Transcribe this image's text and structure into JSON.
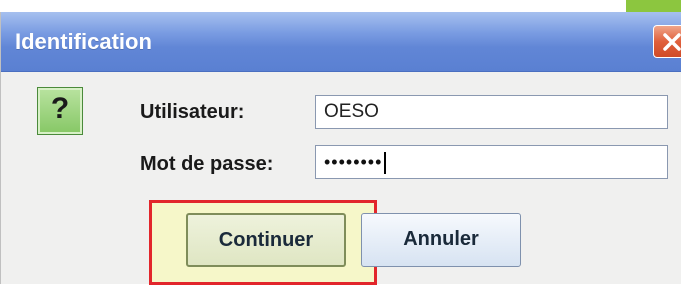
{
  "dialog": {
    "title": "Identification"
  },
  "form": {
    "username_label": "Utilisateur:",
    "username_value": "OESO",
    "password_label": "Mot de passe:",
    "password_masked": "••••••••"
  },
  "buttons": {
    "continue_label": "Continuer",
    "cancel_label": "Annuler"
  },
  "icons": {
    "help": "question-mark-icon",
    "close": "close-icon"
  },
  "colors": {
    "titlebar": "#6186d6",
    "close_button": "#e0603c",
    "highlight_border": "#e2262b",
    "help_icon": "#86c765",
    "corner_tab": "#8cc63f"
  }
}
